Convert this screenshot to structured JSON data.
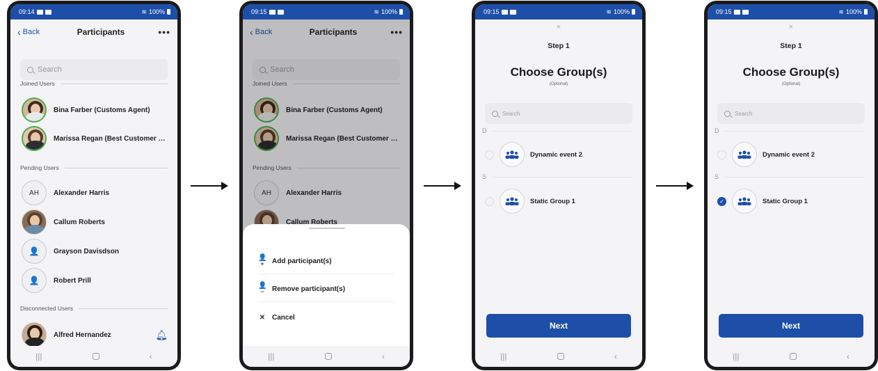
{
  "status_bars": [
    {
      "time": "09:14",
      "battery": "100%"
    },
    {
      "time": "09:15",
      "battery": "100%"
    },
    {
      "time": "09:15",
      "battery": "100%"
    },
    {
      "time": "09:15",
      "battery": "100%"
    }
  ],
  "participants": {
    "back_label": "Back",
    "title": "Participants",
    "more_label": "•••",
    "search_placeholder": "Search",
    "sections": {
      "joined": "Joined Users",
      "pending": "Pending Users",
      "disconnected": "Disconnected Users"
    },
    "joined_users": [
      {
        "name": "Bina Farber (Customs Agent)"
      },
      {
        "name": "Marissa Regan (Best Customer Su..."
      }
    ],
    "pending_users": [
      {
        "name": "Alexander Harris",
        "initials": "AH"
      },
      {
        "name": "Callum Roberts"
      },
      {
        "name": "Grayson Davisdson"
      },
      {
        "name": "Robert Prill"
      }
    ],
    "disconnected_users": [
      {
        "name": "Alfred Hernandez"
      }
    ]
  },
  "action_sheet": {
    "items": [
      {
        "label": "Add participant(s)",
        "icon": "add-person-icon"
      },
      {
        "label": "Remove participant(s)",
        "icon": "remove-person-icon"
      },
      {
        "label": "Cancel",
        "icon": "close-icon"
      }
    ]
  },
  "choose_group": {
    "close_label": "×",
    "step": "Step 1",
    "title": "Choose Group(s)",
    "subtitle": "(Optional)",
    "search_placeholder": "Search",
    "letters": [
      "D",
      "S"
    ],
    "groups": [
      {
        "name": "Dynamic event 2"
      },
      {
        "name": "Static Group 1"
      }
    ],
    "next_label": "Next",
    "selected_after": "Static Group 1"
  },
  "colors": {
    "accent": "#1e4fa8",
    "online_ring": "#4caf50"
  }
}
